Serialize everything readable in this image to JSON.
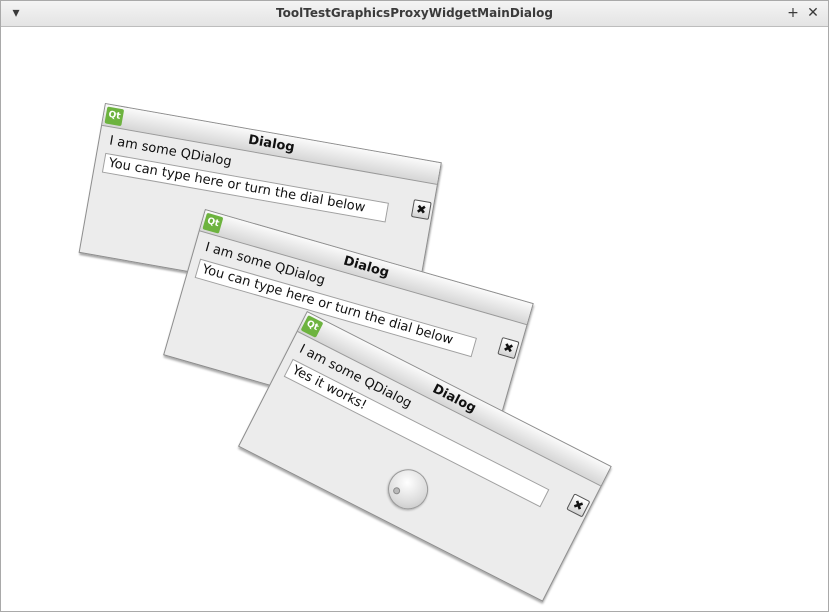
{
  "window": {
    "title": "ToolTestGraphicsProxyWidgetMainDialog",
    "menu_glyph": "▾",
    "maximize_glyph": "+",
    "close_glyph": "✕"
  },
  "dialogs": [
    {
      "logo": "Qt",
      "title": "Dialog",
      "label": "I am some QDialog",
      "input_value": "You can type here or turn the dial below",
      "close_glyph": "✖"
    },
    {
      "logo": "Qt",
      "title": "Dialog",
      "label": "I am some QDialog",
      "input_value": "You can type here or turn the dial below",
      "close_glyph": "✖"
    },
    {
      "logo": "Qt",
      "title": "Dialog",
      "label": "I am some QDialog",
      "input_value": "Yes it works!",
      "close_glyph": "✖"
    }
  ]
}
